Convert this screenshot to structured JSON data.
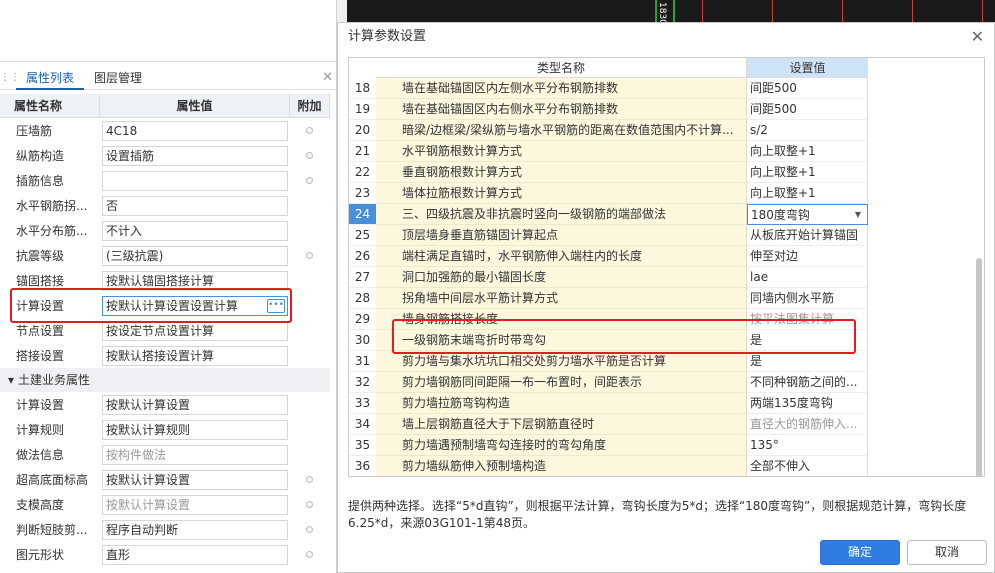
{
  "left_panel": {
    "tabs": [
      "属性列表",
      "图层管理"
    ],
    "header": {
      "name": "属性名称",
      "value": "属性值",
      "extra": "附加"
    },
    "rows": [
      {
        "name": "压墙筋",
        "value": "4C18",
        "dot": true
      },
      {
        "name": "纵筋构造",
        "value": "设置插筋",
        "dot": true
      },
      {
        "name": "插筋信息",
        "value": "",
        "dot": true
      },
      {
        "name": "水平钢筋拐...",
        "value": "否",
        "dot": false
      },
      {
        "name": "水平分布筋...",
        "value": "不计入",
        "dot": false
      },
      {
        "name": "抗震等级",
        "value": "(三级抗震)",
        "dot": true
      },
      {
        "name": "锚固搭接",
        "value": "按默认锚固搭接计算",
        "dot": false
      },
      {
        "name": "计算设置",
        "value": "按默认计算设置设置计算",
        "dot": false,
        "selected": true
      },
      {
        "name": "节点设置",
        "value": "按设定节点设置计算",
        "dot": false
      },
      {
        "name": "搭接设置",
        "value": "按默认搭接设置计算",
        "dot": false
      }
    ],
    "section_title": "土建业务属性",
    "rows2": [
      {
        "name": "计算设置",
        "value": "按默认计算设置",
        "dot": false,
        "gray": false
      },
      {
        "name": "计算规则",
        "value": "按默认计算规则",
        "dot": false,
        "gray": false
      },
      {
        "name": "做法信息",
        "value": "按构件做法",
        "dot": false,
        "gray": true
      },
      {
        "name": "超高底面标高",
        "value": "按默认计算设置",
        "dot": true,
        "gray": false
      },
      {
        "name": "支模高度",
        "value": "按默认计算设置",
        "dot": true,
        "gray": true
      },
      {
        "name": "判断短肢剪...",
        "value": "程序自动判断",
        "dot": true,
        "gray": false
      },
      {
        "name": "图元形状",
        "value": "直形",
        "dot": true,
        "gray": false
      }
    ]
  },
  "canvas": {
    "label": "1830"
  },
  "dialog": {
    "title": "计算参数设置",
    "col_name": "类型名称",
    "col_value": "设置值",
    "rows": [
      {
        "no": "18",
        "name": "墙在基础锚固区内左侧水平分布钢筋排数",
        "value": "间距500"
      },
      {
        "no": "19",
        "name": "墙在基础锚固区内右侧水平分布钢筋排数",
        "value": "间距500"
      },
      {
        "no": "20",
        "name": "暗梁/边框梁/梁纵筋与墙水平钢筋的距离在数值范围内不计算...",
        "value": "s/2"
      },
      {
        "no": "21",
        "name": "水平钢筋根数计算方式",
        "value": "向上取整+1"
      },
      {
        "no": "22",
        "name": "垂直钢筋根数计算方式",
        "value": "向上取整+1"
      },
      {
        "no": "23",
        "name": "墙体拉筋根数计算方式",
        "value": "向上取整+1"
      },
      {
        "no": "24",
        "name": "三、四级抗震及非抗震时竖向一级钢筋的端部做法",
        "value": "180度弯钩",
        "active": true
      },
      {
        "no": "25",
        "name": "顶层墙身垂直筋锚固计算起点",
        "value": "从板底开始计算锚固"
      },
      {
        "no": "26",
        "name": "端柱满足直锚时，水平钢筋伸入端柱内的长度",
        "value": "伸至对边"
      },
      {
        "no": "27",
        "name": "洞口加强筋的最小锚固长度",
        "value": "lae"
      },
      {
        "no": "28",
        "name": "拐角墙中间层水平筋计算方式",
        "value": "同墙内侧水平筋"
      },
      {
        "no": "29",
        "name": "墙身钢筋搭接长度",
        "value": "按平法图集计算",
        "gray": true
      },
      {
        "no": "30",
        "name": "一级钢筋末端弯折时带弯勾",
        "value": "是"
      },
      {
        "no": "31",
        "name": "剪力墙与集水坑坑口相交处剪力墙水平筋是否计算",
        "value": "是"
      },
      {
        "no": "32",
        "name": "剪力墙钢筋同间距隔一布一布置时，间距表示",
        "value": "不同种钢筋之间的..."
      },
      {
        "no": "33",
        "name": "剪力墙拉筋弯钩构造",
        "value": "两端135度弯钩"
      },
      {
        "no": "34",
        "name": "墙上层钢筋直径大于下层钢筋直径时",
        "value": "直径大的钢筋伸入...",
        "gray": true
      },
      {
        "no": "35",
        "name": "剪力墙遇预制墙弯勾连接时的弯勾角度",
        "value": "135°"
      },
      {
        "no": "36",
        "name": "剪力墙纵筋伸入预制墙构造",
        "value": "全部不伸入"
      }
    ],
    "description": "提供两种选择。选择“5*d直钩”，则根据平法计算，弯钩长度为5*d；选择“180度弯钩”，则根据规范计算，弯钩长度6.25*d，来源03G101-1第48页。",
    "ok_label": "确定",
    "cancel_label": "取消"
  },
  "colors": {
    "accent": "#2f7de1",
    "highlight": "#e02020",
    "row_bg": "#fdf7de"
  }
}
